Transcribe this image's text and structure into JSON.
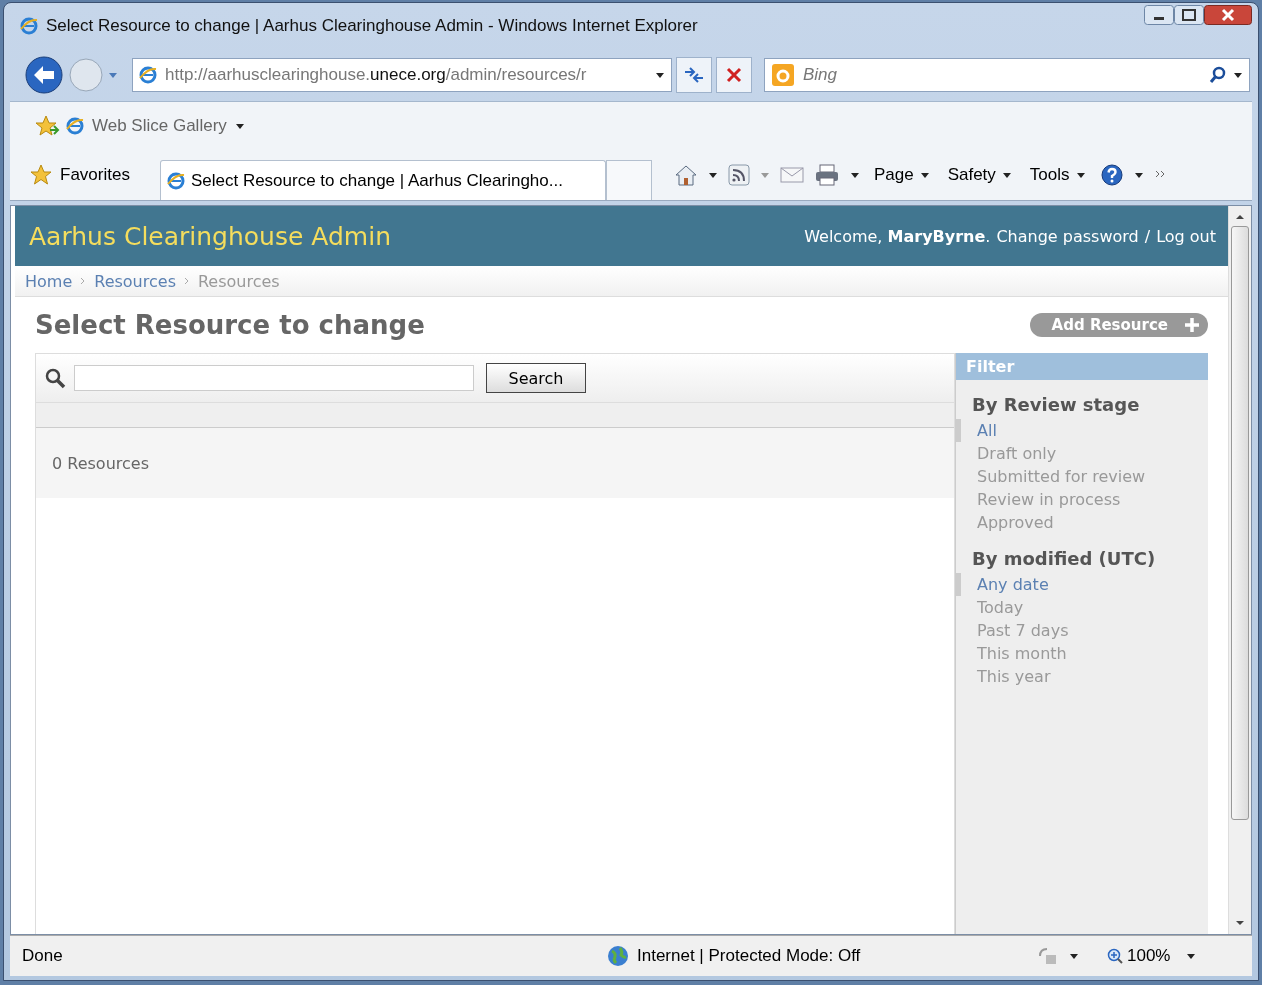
{
  "window": {
    "title": "Select Resource to change | Aarhus Clearinghouse Admin - Windows Internet Explorer"
  },
  "address_bar": {
    "url": "http://aarhusclearinghouse.**unece.org**/admin/resources/r",
    "search_placeholder": "Bing"
  },
  "favorites_bar": {
    "items": [
      "Web Slice Gallery"
    ]
  },
  "command_bar": {
    "favorites": "Favorites",
    "tab": "Select Resource to change | Aarhus Clearingho...",
    "menus": [
      "Page",
      "Safety",
      "Tools"
    ]
  },
  "page": {
    "site_title": "Aarhus Clearinghouse Admin",
    "welcome": "Welcome, **MaryByrne**.",
    "user_links": [
      "Change password",
      "Log out"
    ],
    "link_separator": "/",
    "breadcrumbs": [
      {
        "label": "Home",
        "link": true
      },
      {
        "label": "Resources",
        "link": true
      },
      {
        "label": "Resources",
        "link": false
      }
    ],
    "heading": "Select Resource to change",
    "add_button": "Add Resource",
    "search_button": "Search",
    "result_count": "0 Resources",
    "filter": {
      "title": "Filter",
      "groups": [
        {
          "title": "By Review stage",
          "options": [
            {
              "label": "All",
              "selected": true
            },
            {
              "label": "Draft only",
              "selected": false
            },
            {
              "label": "Submitted for review",
              "selected": false
            },
            {
              "label": "Review in process",
              "selected": false
            },
            {
              "label": "Approved",
              "selected": false
            }
          ]
        },
        {
          "title": "By modified (UTC)",
          "options": [
            {
              "label": "Any date",
              "selected": true
            },
            {
              "label": "Today",
              "selected": false
            },
            {
              "label": "Past 7 days",
              "selected": false
            },
            {
              "label": "This month",
              "selected": false
            },
            {
              "label": "This year",
              "selected": false
            }
          ]
        }
      ]
    }
  },
  "status_bar": {
    "status": "Done",
    "zone": "Internet | Protected Mode: Off",
    "zoom": "100%"
  }
}
